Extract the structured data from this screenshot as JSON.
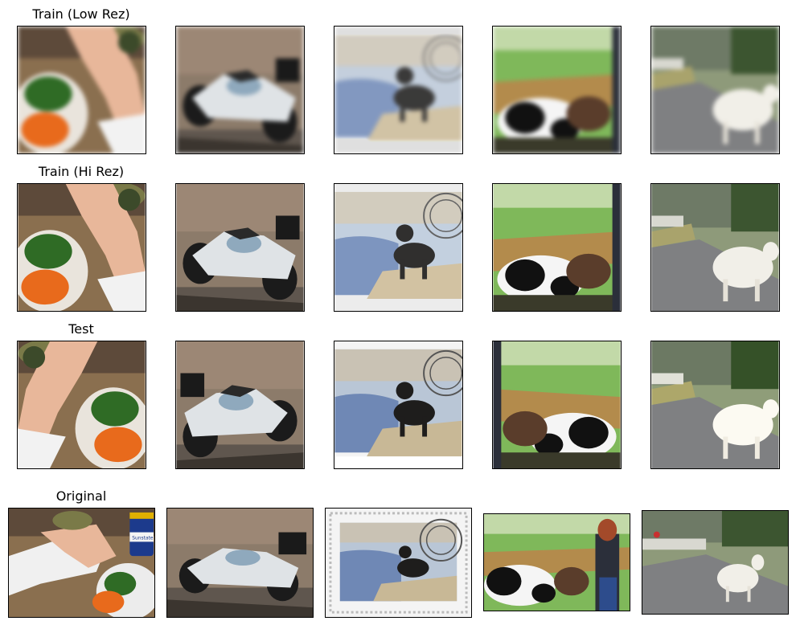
{
  "rows": [
    {
      "title": "Train (Low Rez)"
    },
    {
      "title": "Train (Hi Rez)"
    },
    {
      "title": "Test"
    },
    {
      "title": "Original"
    }
  ],
  "images": [
    {
      "name": "hands-vegetables-photo"
    },
    {
      "name": "motorcycle-photo"
    },
    {
      "name": "rottweiler-stamp-photo"
    },
    {
      "name": "cows-fence-photo"
    },
    {
      "name": "sheep-road-photo"
    }
  ],
  "original_labels": {
    "jar_label": "Sunstate"
  }
}
